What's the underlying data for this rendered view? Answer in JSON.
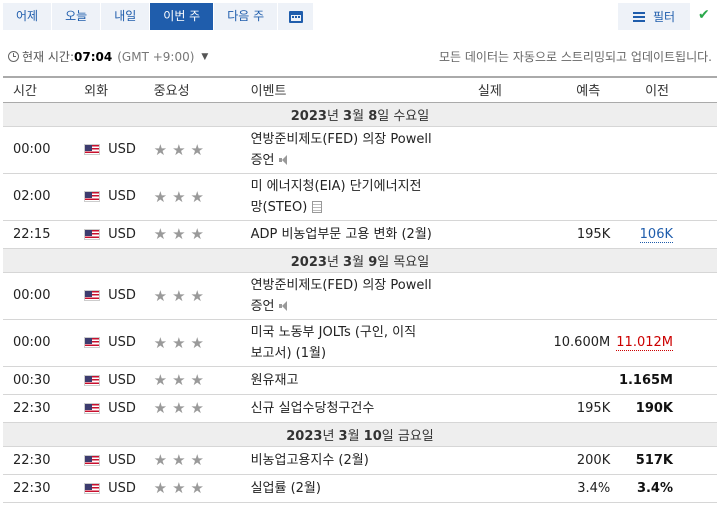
{
  "tabs": [
    {
      "label": "어제",
      "active": false
    },
    {
      "label": "오늘",
      "active": false
    },
    {
      "label": "내일",
      "active": false
    },
    {
      "label": "이번 주",
      "active": true
    },
    {
      "label": "다음 주",
      "active": false
    }
  ],
  "calendar_icon": "calendar-icon",
  "filter": {
    "label": "필터",
    "icon": "filter-icon"
  },
  "check_icon": "check-icon",
  "time": {
    "prefix": "현재 시간:",
    "value": "07:04",
    "tz": "(GMT +9:00)",
    "note": "모든 데이터는 자동으로 스트리밍되고 업데이트됩니다."
  },
  "headers": {
    "time": "시간",
    "currency": "외화",
    "importance": "중요성",
    "event": "이벤트",
    "actual": "실제",
    "forecast": "예측",
    "previous": "이전"
  },
  "days": [
    {
      "year": "2023",
      "y_suffix": "년 ",
      "month": "3",
      "m_suffix": "월 ",
      "day": "8",
      "d_suffix": "일 수요일",
      "rows": [
        {
          "time": "00:00",
          "currency": "USD",
          "stars": "★★★",
          "event_line1": "연방준비제도(FED) 의장 Powell",
          "event_line2": "증언",
          "actual": "",
          "forecast": "",
          "previous": ""
        },
        {
          "time": "02:00",
          "currency": "USD",
          "stars": "★★★",
          "event_line1": "미 에너지청(EIA) 단기에너지전",
          "event_line2": "망(STEO)",
          "actual": "",
          "forecast": "",
          "previous": ""
        },
        {
          "time": "22:15",
          "currency": "USD",
          "stars": "★★★",
          "event": "ADP 비농업부문 고용 변화 (2월)",
          "actual": "",
          "forecast": "195K",
          "previous": "106K"
        }
      ]
    },
    {
      "year": "2023",
      "y_suffix": "년 ",
      "month": "3",
      "m_suffix": "월 ",
      "day": "9",
      "d_suffix": "일 목요일",
      "rows": [
        {
          "time": "00:00",
          "currency": "USD",
          "stars": "★★★",
          "event_line1": "연방준비제도(FED) 의장 Powell",
          "event_line2": "증언",
          "actual": "",
          "forecast": "",
          "previous": ""
        },
        {
          "time": "00:00",
          "currency": "USD",
          "stars": "★★★",
          "event_line1": "미국 노동부 JOLTs (구인, 이직",
          "event_line2": "보고서) (1월)",
          "actual": "",
          "forecast": "10.600M",
          "previous": "11.012M"
        },
        {
          "time": "00:30",
          "currency": "USD",
          "stars": "★★★",
          "event": "원유재고",
          "actual": "",
          "forecast": "",
          "previous": "1.165M"
        },
        {
          "time": "22:30",
          "currency": "USD",
          "stars": "★★★",
          "event": "신규 실업수당청구건수",
          "actual": "",
          "forecast": "195K",
          "previous": "190K"
        }
      ]
    },
    {
      "year": "2023",
      "y_suffix": "년 ",
      "month": "3",
      "m_suffix": "월 ",
      "day": "10",
      "d_suffix": "일 금요일",
      "rows": [
        {
          "time": "22:30",
          "currency": "USD",
          "stars": "★★★",
          "event": "비농업고용지수 (2월)",
          "actual": "",
          "forecast": "200K",
          "previous": "517K"
        },
        {
          "time": "22:30",
          "currency": "USD",
          "stars": "★★★",
          "event": "실업률 (2월)",
          "actual": "",
          "forecast": "3.4%",
          "previous": "3.4%"
        }
      ]
    }
  ],
  "colors": {
    "accent": "#1f5dac",
    "tab_bg": "#eef2f8",
    "check": "#2aa84a",
    "previous_worse": "#cc0000"
  }
}
